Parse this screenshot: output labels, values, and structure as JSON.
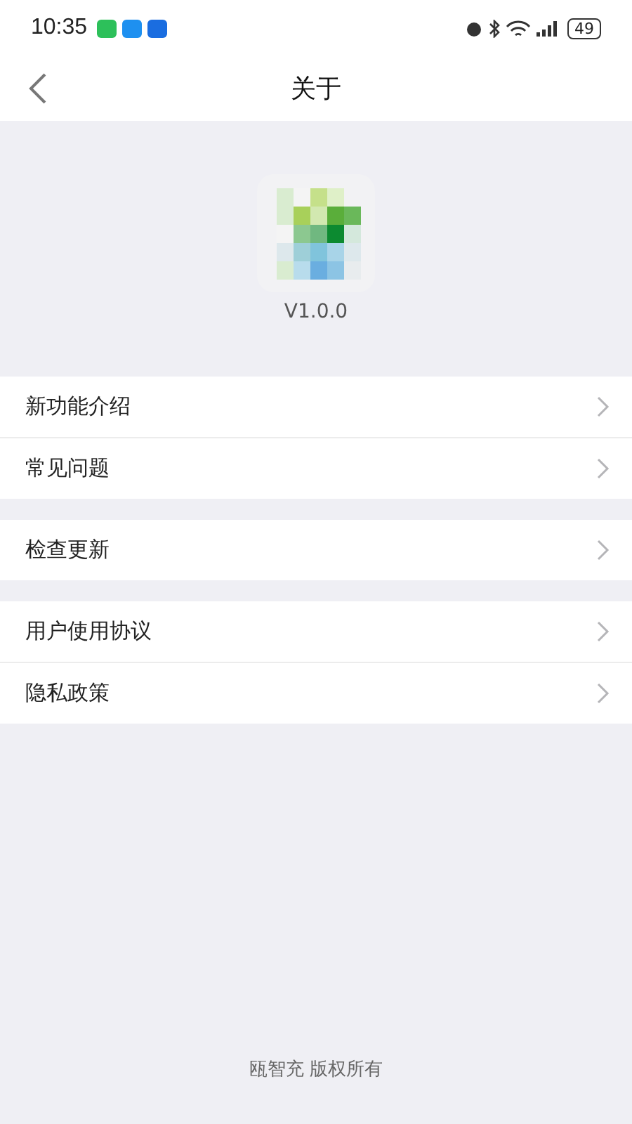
{
  "status_bar": {
    "time": "10:35",
    "battery": "49"
  },
  "nav": {
    "title": "关于"
  },
  "app": {
    "version": "V1.0.0"
  },
  "groups": [
    {
      "items": [
        {
          "label": "新功能介绍"
        },
        {
          "label": "常见问题"
        }
      ]
    },
    {
      "items": [
        {
          "label": "检查更新"
        }
      ]
    },
    {
      "items": [
        {
          "label": "用户使用协议"
        },
        {
          "label": "隐私政策"
        }
      ]
    }
  ],
  "footer": "瓯智充 版权所有"
}
